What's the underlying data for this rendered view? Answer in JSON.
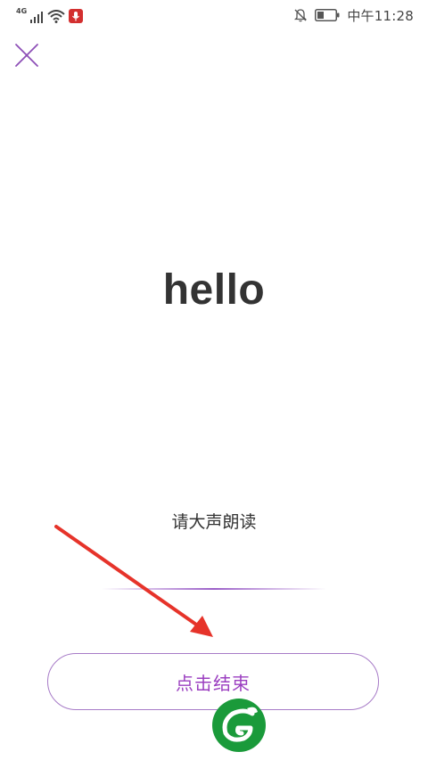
{
  "status_bar": {
    "network": "4G",
    "time": "中午11:28",
    "icons": [
      "signal-icon",
      "wifi-icon",
      "mic-icon",
      "mute-bell-icon",
      "battery-icon"
    ]
  },
  "header": {
    "close_icon": "close-icon"
  },
  "word": {
    "text": "hello"
  },
  "instruction": {
    "text": "请大声朗读"
  },
  "actions": {
    "finish_label": "点击结束"
  },
  "colors": {
    "accent": "#9b3fc0",
    "annotation": "#e6332a",
    "watermark": "#1a9a3a"
  }
}
